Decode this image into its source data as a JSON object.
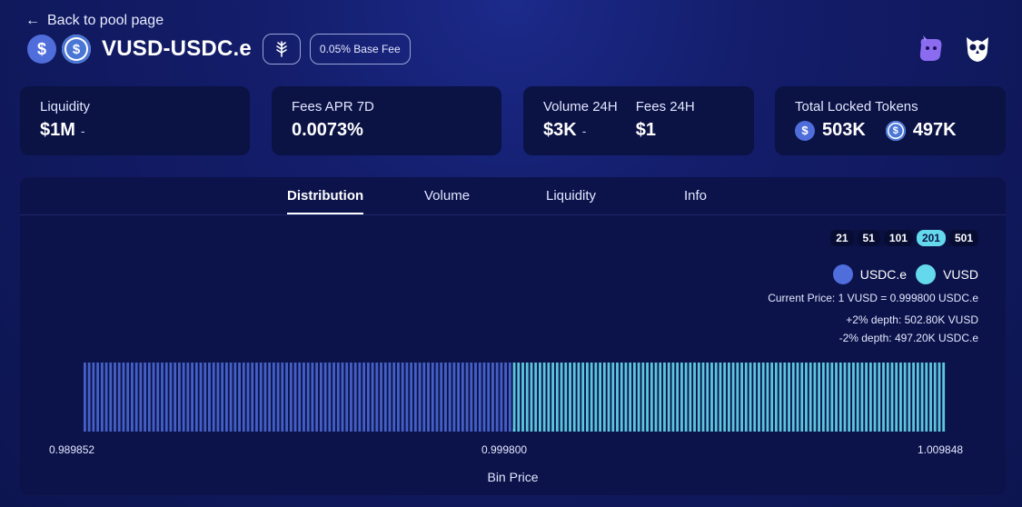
{
  "nav": {
    "back_label": "Back to pool page"
  },
  "pool": {
    "pair_name": "VUSD-USDC.e",
    "fee_badge": "0.05% Base Fee",
    "token_a_icon": "vusd-icon",
    "token_b_icon": "usdc-icon"
  },
  "stats": {
    "liquidity": {
      "label": "Liquidity",
      "value": "$1M",
      "trend": "-"
    },
    "fees_apr": {
      "label": "Fees APR 7D",
      "value": "0.0073%"
    },
    "volume_24h": {
      "label": "Volume 24H",
      "value": "$3K",
      "trend": "-"
    },
    "fees_24h": {
      "label": "Fees 24H",
      "value": "$1"
    },
    "locked": {
      "label": "Total Locked Tokens",
      "vusd_amount": "503K",
      "usdc_amount": "497K"
    }
  },
  "tabs": [
    "Distribution",
    "Volume",
    "Liquidity",
    "Info"
  ],
  "active_tab": "Distribution",
  "range_options": [
    "21",
    "51",
    "101",
    "201",
    "501"
  ],
  "range_selected": "201",
  "legend": {
    "usdc_label": "USDC.e",
    "vusd_label": "VUSD",
    "usdc_color": "#4f6ddb",
    "vusd_color": "#64d9ee"
  },
  "info": {
    "current_price": "Current Price: 1 VUSD = 0.999800 USDC.e",
    "plus_depth": "+2% depth: 502.80K VUSD",
    "minus_depth": "-2% depth: 497.20K USDC.e"
  },
  "chart_data": {
    "type": "bar",
    "xlabel": "Bin Price",
    "x_ticks": [
      "0.989852",
      "0.999800",
      "1.009848"
    ],
    "bin_count": 201,
    "active_bin_index": 100,
    "series": [
      {
        "name": "USDC.e",
        "bins": "0-99",
        "relative_height": 1.0
      },
      {
        "name": "VUSD",
        "bins": "100-200",
        "relative_height": 1.0
      }
    ]
  }
}
